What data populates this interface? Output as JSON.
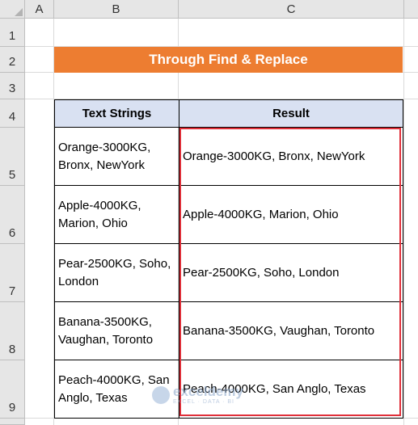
{
  "sheet": {
    "columns": [
      "A",
      "B",
      "C"
    ],
    "rows": [
      "1",
      "2",
      "3",
      "4",
      "5",
      "6",
      "7",
      "8",
      "9"
    ]
  },
  "banner": {
    "title": "Through Find & Replace",
    "color": "#ed7d31"
  },
  "table": {
    "headers": [
      "Text Strings",
      "Result"
    ],
    "rows": [
      {
        "text": "Orange-3000KG, Bronx, NewYork",
        "result": "Orange-3000KG, Bronx, NewYork"
      },
      {
        "text": "Apple-4000KG, Marion, Ohio",
        "result": "Apple-4000KG, Marion, Ohio"
      },
      {
        "text": "Pear-2500KG, Soho, London",
        "result": "Pear-2500KG, Soho, London"
      },
      {
        "text": "Banana-3500KG, Vaughan, Toronto",
        "result": "Banana-3500KG, Vaughan, Toronto"
      },
      {
        "text": "Peach-4000KG, San Anglo, Texas",
        "result": "Peach-4000KG, San Anglo, Texas"
      }
    ],
    "header_bg": "#d9e1f2",
    "highlight_color": "#e0303a"
  },
  "watermark": {
    "name": "exceldemy",
    "tagline": "EXCEL · DATA · BI"
  }
}
